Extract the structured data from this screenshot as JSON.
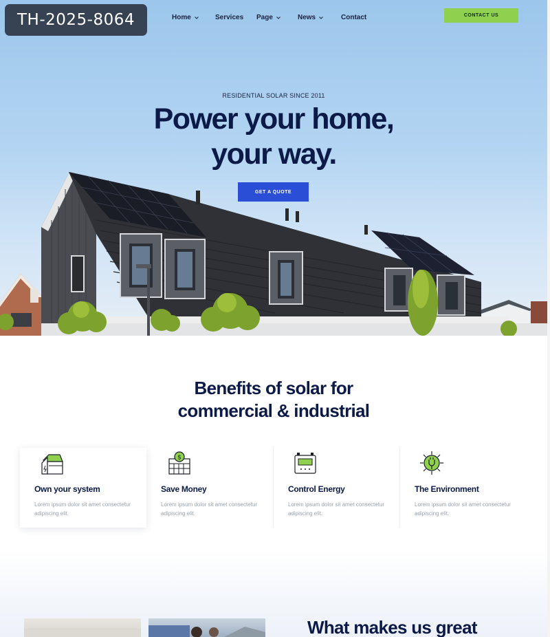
{
  "badge": {
    "text": "TH-2025-8064"
  },
  "nav": {
    "items": [
      {
        "label": "Home",
        "has_dropdown": true
      },
      {
        "label": "Services",
        "has_dropdown": false
      },
      {
        "label": "Page",
        "has_dropdown": true
      },
      {
        "label": "News",
        "has_dropdown": true
      },
      {
        "label": "Contact",
        "has_dropdown": false
      }
    ],
    "cta_label": "CONTACT US"
  },
  "hero": {
    "eyebrow": "RESIDENTIAL SOLAR SINCE 2011",
    "headline_line1": "Power your home,",
    "headline_line2": "your way.",
    "button_label": "GET A QUOTE"
  },
  "benefits": {
    "title_line1": "Benefits of solar for",
    "title_line2": "commercial & industrial",
    "cards": [
      {
        "icon": "solar-house-icon",
        "title": "Own your system",
        "text": "Lorem ipsum dolor sit amet consectetur adipiscing elit."
      },
      {
        "icon": "money-grid-icon",
        "title": "Save Money",
        "text": "Lorem ipsum dolor sit amet consectetur adipiscing elit."
      },
      {
        "icon": "energy-meter-icon",
        "title": "Control Energy",
        "text": "Lorem ipsum dolor sit amet consectetur adipiscing elit."
      },
      {
        "icon": "eco-plug-icon",
        "title": "The Environment",
        "text": "Lorem ipsum dolor sit amet consectetur adipiscing elit."
      }
    ]
  },
  "why": {
    "title": "What makes us great"
  },
  "colors": {
    "accent_green": "#8fd14f",
    "primary_blue": "#2a4fd6",
    "navy": "#0c1a47"
  }
}
